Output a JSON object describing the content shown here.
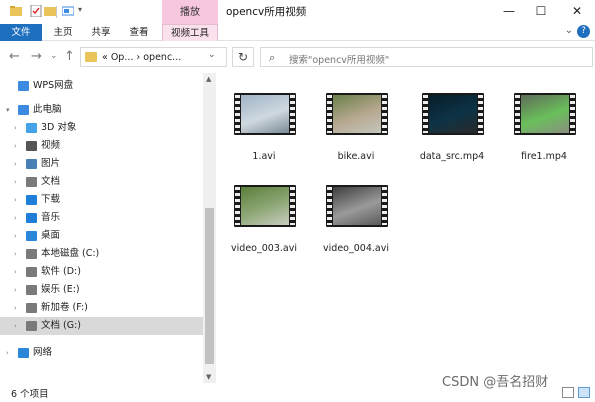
{
  "titlebar": {
    "contextual_tab": "播放",
    "title": "opencv所用视频",
    "minimize": "—",
    "maximize": "☐",
    "close": "✕"
  },
  "ribbon": {
    "tabs": [
      "文件",
      "主页",
      "共享",
      "查看",
      "视频工具"
    ],
    "expand": "⌄",
    "help": "?"
  },
  "address": {
    "back": "←",
    "forward": "→",
    "recent": "⌄",
    "up": "↑",
    "path": "« Op... › openc...",
    "dropdown": "⌄",
    "refresh": "↻",
    "search_placeholder": "搜索\"opencv所用视频\""
  },
  "nav": {
    "items": [
      {
        "label": "WPS网盘",
        "icon": "cloud-icon",
        "color": "#3d8be0"
      },
      {
        "label": "此电脑",
        "icon": "computer-icon",
        "color": "#3d8be0"
      },
      {
        "label": "3D 对象",
        "icon": "cube-icon",
        "color": "#47a3e8"
      },
      {
        "label": "视频",
        "icon": "video-icon",
        "color": "#555555"
      },
      {
        "label": "图片",
        "icon": "picture-icon",
        "color": "#4a7fb5"
      },
      {
        "label": "文档",
        "icon": "document-icon",
        "color": "#7a7a7a"
      },
      {
        "label": "下载",
        "icon": "download-icon",
        "color": "#1f7fd8"
      },
      {
        "label": "音乐",
        "icon": "music-icon",
        "color": "#1f7fd8"
      },
      {
        "label": "桌面",
        "icon": "desktop-icon",
        "color": "#2a86d8"
      },
      {
        "label": "本地磁盘 (C:)",
        "icon": "drive-icon",
        "color": "#7a7a7a"
      },
      {
        "label": "软件 (D:)",
        "icon": "drive-icon",
        "color": "#7a7a7a"
      },
      {
        "label": "娱乐 (E:)",
        "icon": "drive-icon",
        "color": "#7a7a7a"
      },
      {
        "label": "新加卷 (F:)",
        "icon": "drive-icon",
        "color": "#7a7a7a"
      },
      {
        "label": "文档 (G:)",
        "icon": "drive-icon",
        "color": "#7a7a7a"
      },
      {
        "label": "网络",
        "icon": "network-icon",
        "color": "#2a86d8"
      }
    ]
  },
  "files": [
    {
      "name": "1.avi",
      "colors": [
        "#9fb3c6",
        "#cfd8df",
        "#7a8a95"
      ]
    },
    {
      "name": "bike.avi",
      "colors": [
        "#6b7f4a",
        "#b7a890",
        "#c4c6bd"
      ]
    },
    {
      "name": "data_src.mp4",
      "colors": [
        "#071d2a",
        "#0d3346",
        "#2a2a2a"
      ]
    },
    {
      "name": "fire1.mp4",
      "colors": [
        "#5f6b5a",
        "#6abf5b",
        "#8a8f80"
      ]
    },
    {
      "name": "video_003.avi",
      "colors": [
        "#5b7f3a",
        "#8fa878",
        "#c9cdc0"
      ]
    },
    {
      "name": "video_004.avi",
      "colors": [
        "#3d3d3d",
        "#9a9a9a",
        "#5a5a5a"
      ]
    }
  ],
  "status": {
    "item_count": "6 个项目"
  },
  "watermark": "CSDN @吾名招财"
}
